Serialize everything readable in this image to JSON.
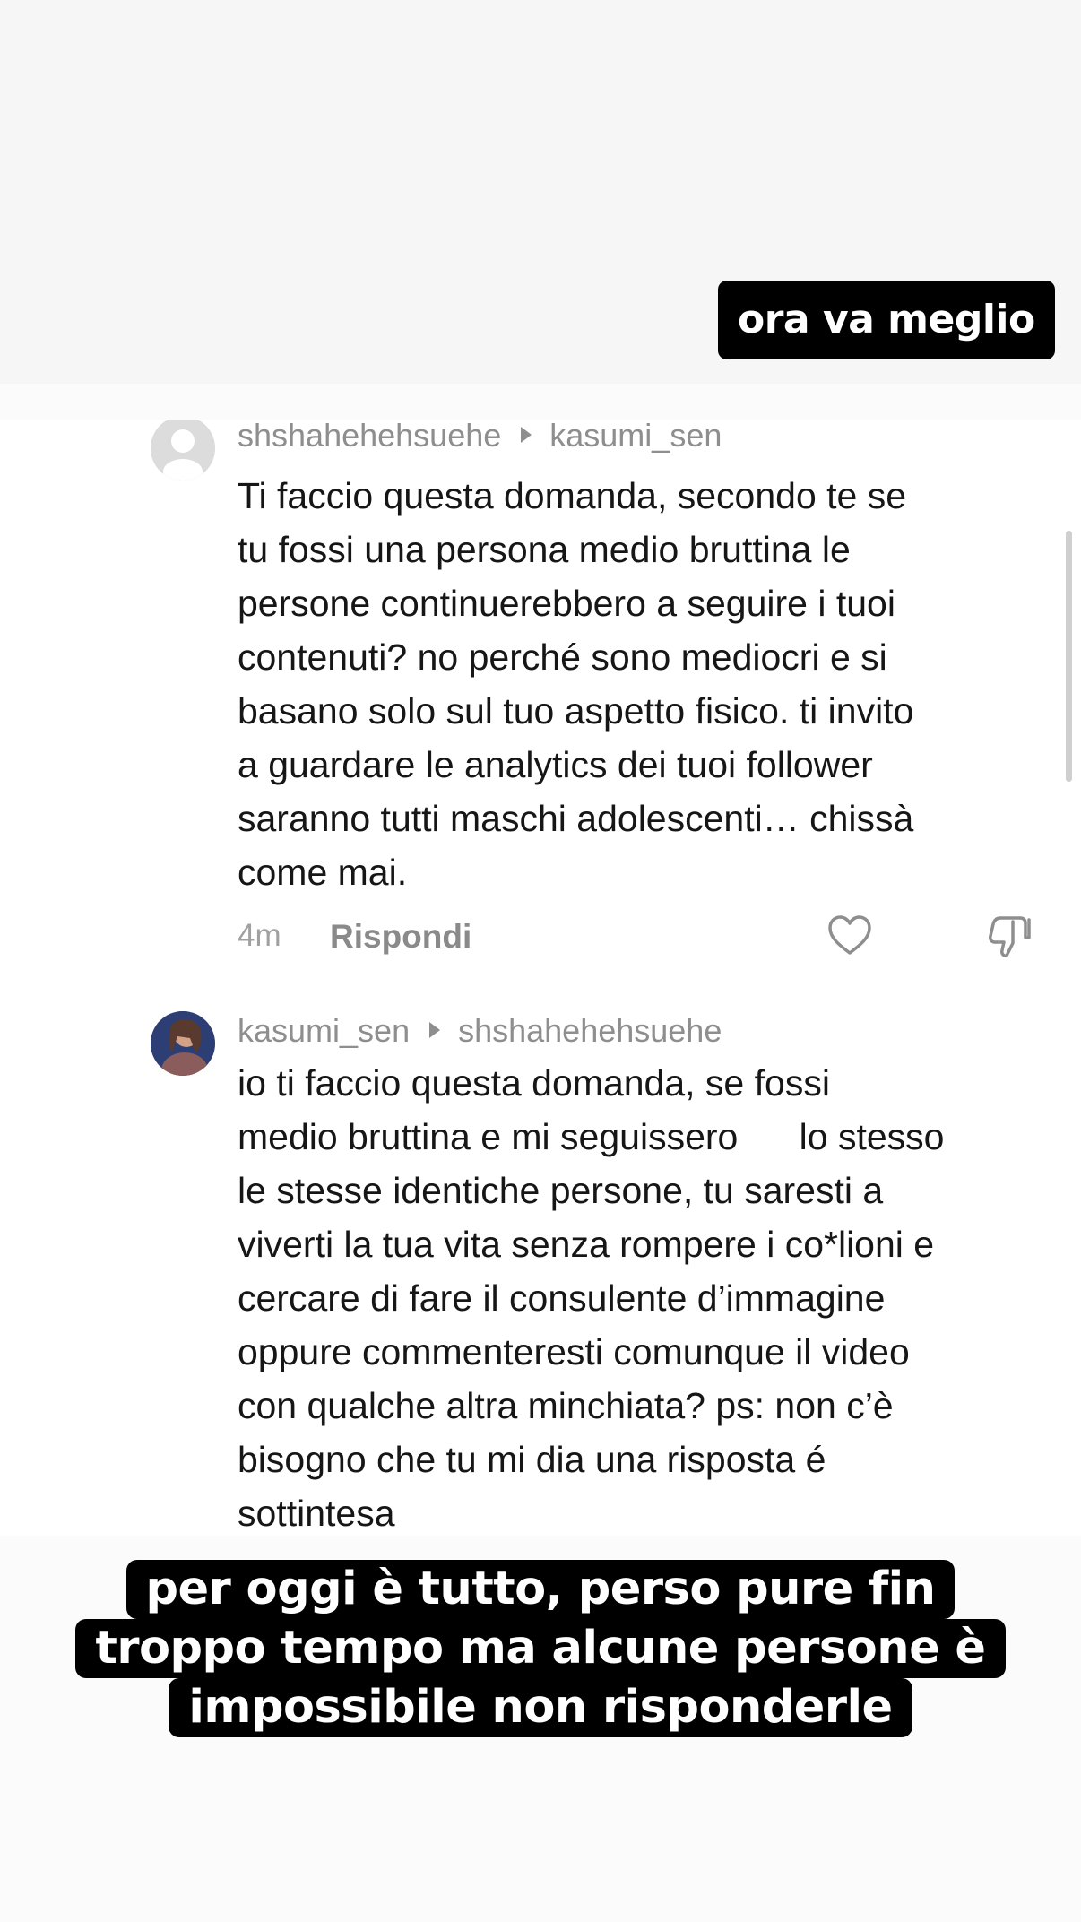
{
  "top_caption": "ora va meglio",
  "comments": [
    {
      "author": "shshahehehsuehe",
      "reply_to": "kasumi_sen",
      "lines": [
        "Ti faccio questa domanda, secondo te se",
        "tu fossi una persona medio bruttina le",
        "persone continuerebbero a seguire i tuoi",
        "contenuti? no perché sono mediocri e si",
        "basano solo sul tuo aspetto fisico. ti invito",
        "a guardare le analytics dei tuoi follower",
        "saranno tutti maschi adolescenti… chissà",
        "come mai."
      ],
      "timestamp": "4m",
      "reply_label": "Rispondi"
    },
    {
      "author": "kasumi_sen",
      "reply_to": "shshahehehsuehe",
      "lines": [
        "io ti faccio questa domanda, se fossi",
        "medio bruttina e mi seguissero      lo stesso",
        "le stesse identiche persone, tu saresti a",
        "viverti la tua vita senza rompere i co*lioni e",
        "cercare di fare il consulente d’immagine",
        "oppure commenteresti comunque il video",
        "con qualche altra minchiata? ps: non c’è",
        "bisogno che tu mi dia una risposta é",
        "sottintesa"
      ]
    }
  ],
  "bottom_caption": [
    "per oggi è tutto, perso pure fin",
    "troppo tempo ma alcune persone è",
    "impossibile non risponderle"
  ]
}
